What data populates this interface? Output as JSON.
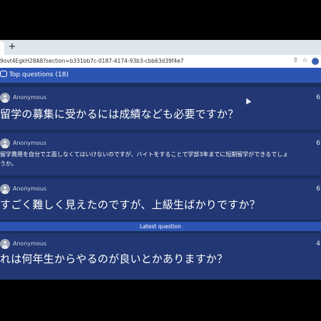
{
  "browser": {
    "tab_close": "×",
    "new_tab": "+",
    "url": "9ovt4EgkH28A8?section=b331bb7c-0187-4174-93b3-cbb63d39f4e7"
  },
  "app": {
    "top_questions_label": "Top questions (18)",
    "latest_label": "Latest question"
  },
  "questions": [
    {
      "author": "Anonymous",
      "count": "6",
      "text": "留学の募集に受かるには成績なども必要ですか？"
    },
    {
      "author": "Anonymous",
      "count": "6",
      "text_line1": "留学費用を自分で工面しなくてはいけないのですが、バイトをすることで学部3年までに短期留学ができるでしょ",
      "text_line2": "うか。"
    },
    {
      "author": "Anonymous",
      "count": "6",
      "text": "すごく難しく見えたのですが、上級生ばかりですか？"
    }
  ],
  "latest_question": {
    "author": "Anonymous",
    "count": "4",
    "text": "れは何年生からやるのが良いとかありますか？"
  }
}
